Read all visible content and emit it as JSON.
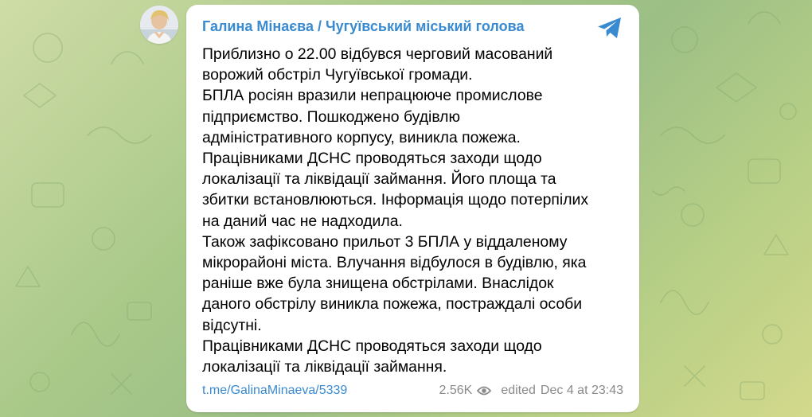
{
  "channel": {
    "name": "Галина Мінаєва / Чугуївський міський голова"
  },
  "message": {
    "paragraphs": [
      "Приблизно о 22.00 відбувся черговий масований ворожий обстріл Чугуївської громади.",
      "БПЛА росіян вразили непрацююче промислове підприємство. Пошкоджено будівлю адміністративного корпусу, виникла пожежа.",
      "Працівниками ДСНС проводяться заходи щодо локалізації та ліквідації займання. Його площа та збитки встановлюються. Інформація щодо потерпілих на даний час не надходила.",
      "Також зафіксовано прильот 3 БПЛА у віддаленому мікрорайоні міста. Влучання відбулося в будівлю, яка раніше вже була знищена обстрілами. Внаслідок даного обстрілу виникла пожежа, постраждалі особи відсутні.",
      "Працівниками ДСНС проводяться заходи щодо локалізації та ліквідації займання."
    ],
    "lines": [
      "Приблизно о 22.00 відбувся черговий масований",
      "ворожий обстріл Чугуївської громади.",
      "БПЛА росіян вразили непрацююче промислове",
      "підприємство. Пошкоджено будівлю",
      "адміністративного корпусу, виникла пожежа.",
      "Працівниками ДСНС проводяться заходи щодо",
      "локалізації та ліквідації займання. Його площа та",
      "збитки встановлюються. Інформація щодо потерпілих",
      "на даний час не надходила.",
      "Також зафіксовано прильот 3 БПЛА у віддаленому",
      "мікрорайоні міста. Влучання відбулося в будівлю, яка",
      "раніше вже була знищена обстрілами. Внаслідок",
      "даного обстрілу виникла пожежа, постраждалі особи",
      "відсутні.",
      "Працівниками ДСНС проводяться заходи щодо",
      "локалізації та ліквідації займання."
    ]
  },
  "footer": {
    "link": "t.me/GalinaMinaeva/5339",
    "views": "2.56K",
    "edited_label": "edited",
    "timestamp": "Dec 4 at 23:43"
  },
  "icons": {
    "share": "telegram-share-icon",
    "views": "eye-icon",
    "avatar": "avatar"
  },
  "colors": {
    "accent": "#3a8ad0",
    "meta": "#8a8a8a",
    "bubble": "#ffffff"
  }
}
